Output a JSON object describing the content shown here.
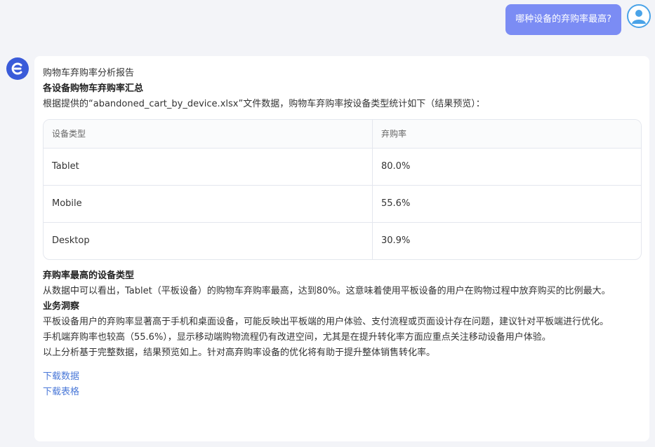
{
  "user": {
    "question": "哪种设备的弃购率最高?"
  },
  "report": {
    "title": "购物车弃购率分析报告",
    "section1_heading": "各设备购物车弃购率汇总",
    "intro": "根据提供的“abandoned_cart_by_device.xlsx”文件数据，购物车弃购率按设备类型统计如下（结果预览）：",
    "table": {
      "headers": [
        "设备类型",
        "弃购率"
      ],
      "rows": [
        [
          "Tablet",
          "80.0%"
        ],
        [
          "Mobile",
          "55.6%"
        ],
        [
          "Desktop",
          "30.9%"
        ]
      ]
    },
    "section2_heading": "弃购率最高的设备类型",
    "section2_text": "从数据中可以看出，Tablet（平板设备）的购物车弃购率最高，达到80%。这意味着使用平板设备的用户在购物过程中放弃购买的比例最大。",
    "section3_heading": "业务洞察",
    "insight1": "平板设备用户的弃购率显著高于手机和桌面设备，可能反映出平板端的用户体验、支付流程或页面设计存在问题，建议针对平板端进行优化。",
    "insight2": "手机端弃购率也较高（55.6%），显示移动端购物流程仍有改进空间，尤其是在提升转化率方面应重点关注移动设备用户体验。",
    "summary": "以上分析基于完整数据，结果预览如上。针对高弃购率设备的优化将有助于提升整体销售转化率。",
    "download_data": "下载数据",
    "download_table": "下载表格"
  },
  "colors": {
    "user_bubble": "#7b8cf4",
    "bot_avatar": "#3a5bd9",
    "link": "#4a78d8"
  },
  "icons": {
    "user_avatar": "user-avatar-icon",
    "bot_avatar": "bot-logo-icon"
  }
}
